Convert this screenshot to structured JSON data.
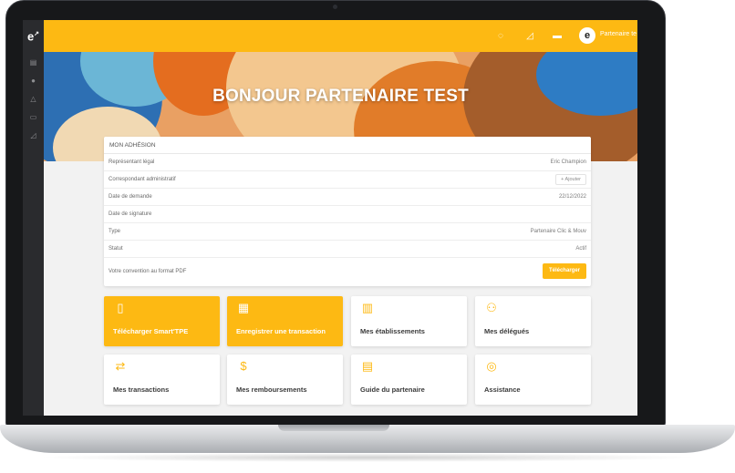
{
  "header": {
    "user_label": "Partenaire te",
    "logo_text": "e"
  },
  "hero": {
    "title": "BONJOUR PARTENAIRE TEST"
  },
  "adhesion": {
    "title": "MON ADHÉSION",
    "rows": [
      {
        "label": "Représentant légal",
        "value": "Eric Champion"
      },
      {
        "label": "Correspondant administratif",
        "button": "+ Ajouter"
      },
      {
        "label": "Date de demande",
        "value": "22/12/2022"
      },
      {
        "label": "Date de signature",
        "value": ""
      },
      {
        "label": "Type",
        "value": "Partenaire Clic & Mouv"
      },
      {
        "label": "Statut",
        "value": "Actif"
      }
    ],
    "pdf_label": "Votre convention au format PDF",
    "download_button": "Télécharger"
  },
  "tiles": [
    {
      "label": "Télécharger Smart'TPE",
      "icon": "phone-icon",
      "style": "yellow"
    },
    {
      "label": "Enregistrer une transaction",
      "icon": "qr-code-icon",
      "style": "yellow"
    },
    {
      "label": "Mes établissements",
      "icon": "building-icon",
      "style": "white"
    },
    {
      "label": "Mes délégués",
      "icon": "users-icon",
      "style": "white"
    },
    {
      "label": "Mes transactions",
      "icon": "transfer-arrows-icon",
      "style": "white"
    },
    {
      "label": "Mes remboursements",
      "icon": "hand-money-icon",
      "style": "white"
    },
    {
      "label": "Guide du partenaire",
      "icon": "pdf-document-icon",
      "style": "white"
    },
    {
      "label": "Assistance",
      "icon": "lifebuoy-icon",
      "style": "white"
    }
  ],
  "colors": {
    "accent": "#fdb913",
    "sidebar": "#2a2b2e",
    "card": "#ffffff"
  }
}
